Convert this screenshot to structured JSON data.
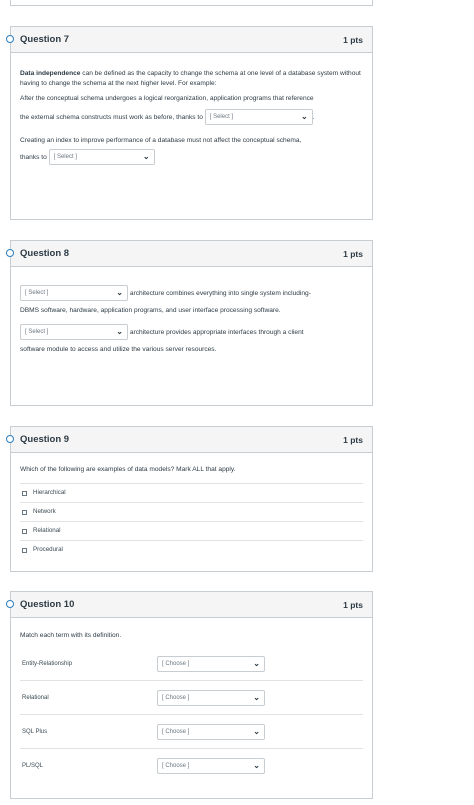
{
  "question7": {
    "title": "Question 7",
    "points": "1 pts",
    "term": "Data independence",
    "intro_rest": " can be defined as the capacity to change the schema at one level of a database system without having to change the schema at the next higher level. For example:",
    "line1_a": "After the conceptual schema undergoes a logical reorganization, application programs that reference",
    "line1_b": "the external schema constructs must work as before, thanks to",
    "select1": "[ Select ]",
    "line2_a": "Creating an index to improve performance of a database must not affect the conceptual schema,",
    "line2_b": "thanks to",
    "select2": "[ Select ]"
  },
  "question8": {
    "title": "Question 8",
    "points": "1 pts",
    "select1": "[ Select ]",
    "text1": "architecture combines everything into single system including-",
    "text1_b": "DBMS software, hardware, application programs, and user interface processing software.",
    "select2": "[ Select ]",
    "text2": "architecture provides appropriate interfaces through a client",
    "text2_b": "software module to access and utilize the various server resources."
  },
  "question9": {
    "title": "Question 9",
    "points": "1 pts",
    "prompt": "Which of the following are examples of data models? Mark ALL that apply.",
    "options": [
      "Hierarchical",
      "Network",
      "Relational",
      "Procedural"
    ]
  },
  "question10": {
    "title": "Question 10",
    "points": "1 pts",
    "prompt": "Match each term with its definition.",
    "rows": [
      {
        "term": "Entity-Relationship",
        "choice": "[ Choose ]"
      },
      {
        "term": "Relational",
        "choice": "[ Choose ]"
      },
      {
        "term": "SQL Plus",
        "choice": "[ Choose ]"
      },
      {
        "term": "PL/SQL",
        "choice": "[ Choose ]"
      }
    ]
  }
}
